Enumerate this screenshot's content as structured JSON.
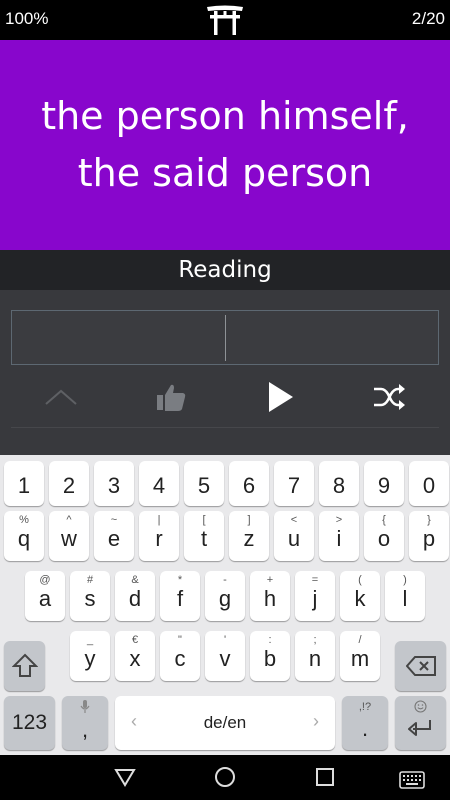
{
  "status": {
    "progress_percent": "100%",
    "counter": "2/20",
    "logo_icon": "torii-gate-icon"
  },
  "card": {
    "prompt": "the person himself, the said person",
    "background": "#8806cc"
  },
  "mode": {
    "label": "Reading"
  },
  "answer": {
    "value": ""
  },
  "controls": {
    "up": "chevron-up-icon",
    "like": "thumbs-up-icon",
    "play": "play-icon",
    "shuffle": "shuffle-icon"
  },
  "keyboard": {
    "row_numbers": [
      "1",
      "2",
      "3",
      "4",
      "5",
      "6",
      "7",
      "8",
      "9",
      "0"
    ],
    "row1": [
      {
        "k": "q",
        "h": "%"
      },
      {
        "k": "w",
        "h": "^"
      },
      {
        "k": "e",
        "h": "~"
      },
      {
        "k": "r",
        "h": "|"
      },
      {
        "k": "t",
        "h": "["
      },
      {
        "k": "z",
        "h": "]"
      },
      {
        "k": "u",
        "h": "<"
      },
      {
        "k": "i",
        "h": ">"
      },
      {
        "k": "o",
        "h": "{"
      },
      {
        "k": "p",
        "h": "}"
      }
    ],
    "row2": [
      {
        "k": "a",
        "h": "@"
      },
      {
        "k": "s",
        "h": "#"
      },
      {
        "k": "d",
        "h": "&"
      },
      {
        "k": "f",
        "h": "*"
      },
      {
        "k": "g",
        "h": "-"
      },
      {
        "k": "h",
        "h": "+"
      },
      {
        "k": "j",
        "h": "="
      },
      {
        "k": "k",
        "h": "("
      },
      {
        "k": "l",
        "h": ")"
      }
    ],
    "row3": [
      {
        "k": "y",
        "h": "_"
      },
      {
        "k": "x",
        "h": "€"
      },
      {
        "k": "c",
        "h": "\""
      },
      {
        "k": "v",
        "h": "'"
      },
      {
        "k": "b",
        "h": ":"
      },
      {
        "k": "n",
        "h": ";"
      },
      {
        "k": "m",
        "h": "/"
      }
    ],
    "symbols_label": "123",
    "comma": ",",
    "period": ".",
    "period_hint": ",!?",
    "space_label": "de/en",
    "space_left_arrow": "‹",
    "space_right_arrow": "›"
  },
  "nav": {
    "back": "back-triangle-icon",
    "home": "home-circle-icon",
    "recents": "recents-square-icon",
    "keyboard": "keyboard-icon"
  }
}
